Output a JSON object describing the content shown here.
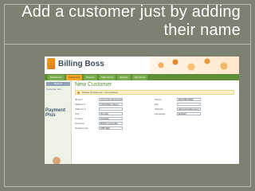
{
  "slide": {
    "title": "Add a customer just by adding their name"
  },
  "app": {
    "name": "Billing Boss",
    "nav_tabs": [
      "Dashboard",
      "Customers",
      "Reports",
      "Sales Docs",
      "Settings",
      "Payments"
    ],
    "active_tab": "Customers",
    "side_options_label": "Options",
    "side_customer_list": "Customer List",
    "payment_plus_label": "Payment Plus",
    "page_heading": "New Customer",
    "notice": "Please choose one * are required",
    "left_fields": [
      {
        "label": "Name *",
        "value": "Acme Developments"
      },
      {
        "label": "Address 1",
        "value": "1234 Main Street"
      },
      {
        "label": "Address 2",
        "value": ""
      },
      {
        "label": "City",
        "value": "Toronto"
      },
      {
        "label": "Country",
        "value": "Canada"
      },
      {
        "label": "Province",
        "value": "British Columbia"
      },
      {
        "label": "Postal Code",
        "value": "V5P 3E9"
      }
    ],
    "right_fields": [
      {
        "label": "Phone",
        "value": "604-555-0000"
      },
      {
        "label": "Fax",
        "value": ""
      },
      {
        "label": "Website",
        "value": "www.acmedev.com"
      },
      {
        "label": "Language",
        "value": "English"
      }
    ]
  }
}
